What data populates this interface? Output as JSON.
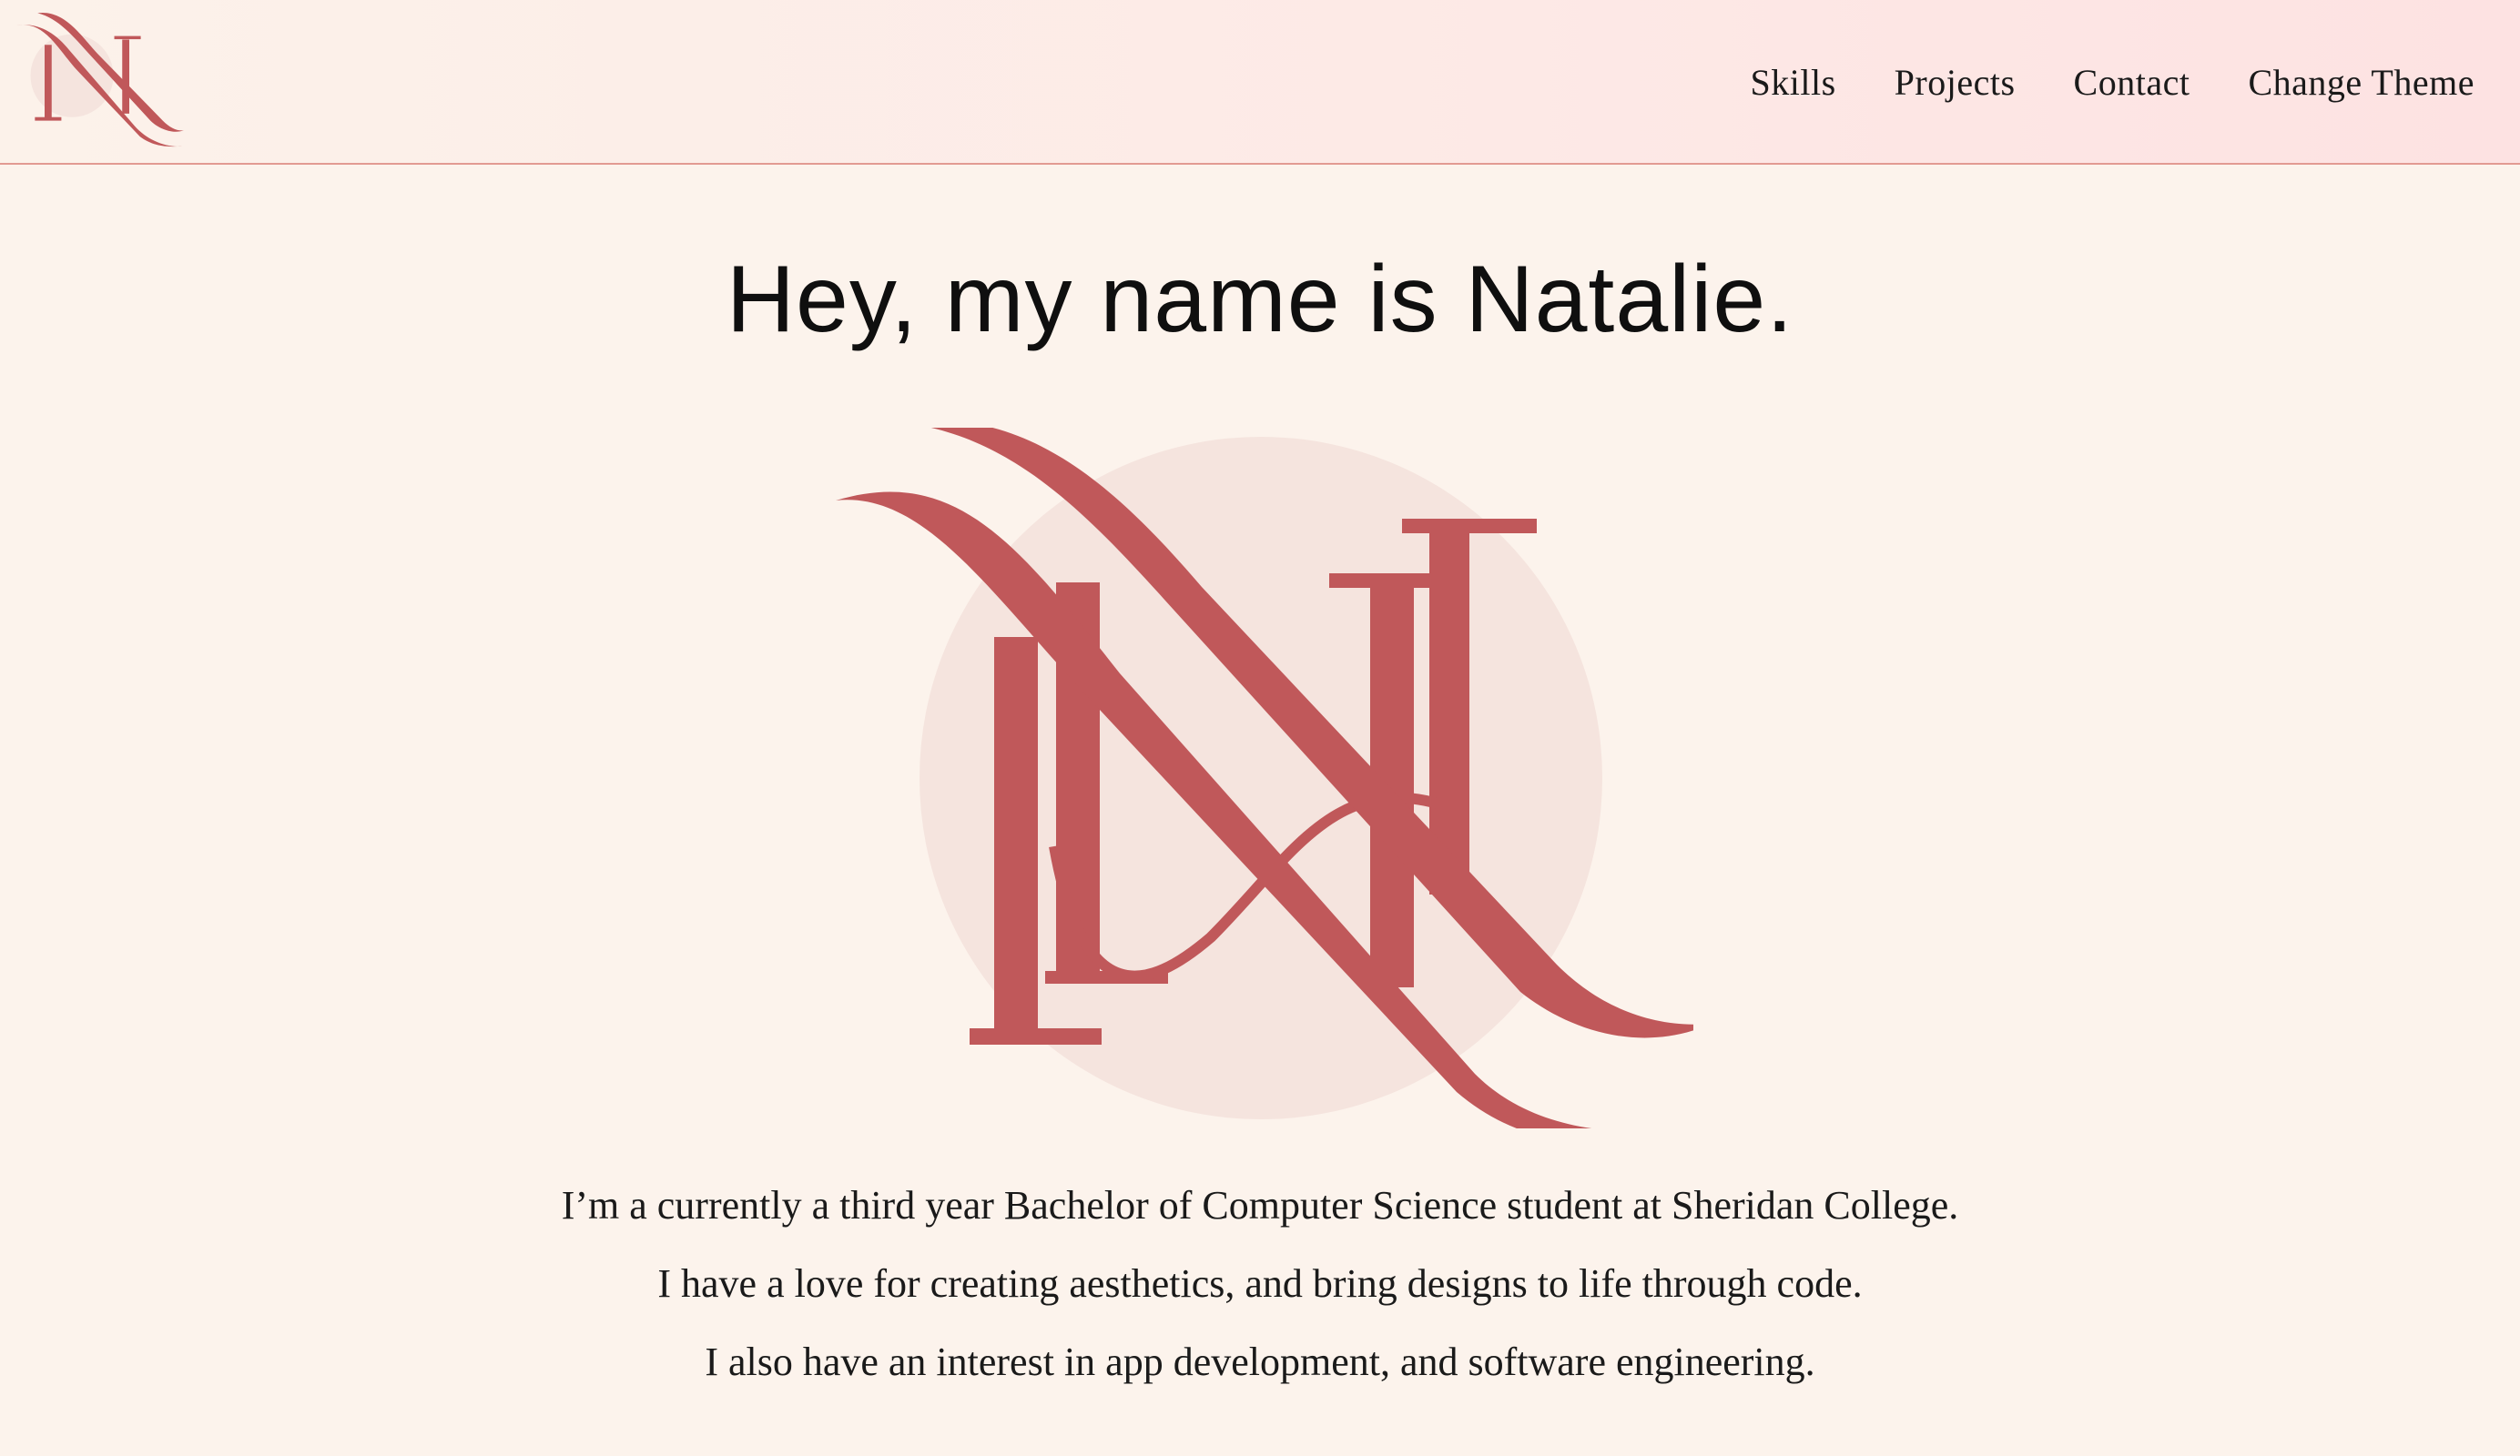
{
  "header": {
    "logo_label": "N",
    "nav": [
      {
        "label": "Skills"
      },
      {
        "label": "Projects"
      },
      {
        "label": "Contact"
      },
      {
        "label": "Change Theme"
      }
    ]
  },
  "hero": {
    "title": "Hey, my name is Natalie.",
    "logo_icon": "monogram-n-logo"
  },
  "intro": {
    "lines": [
      "I’m a currently a third year Bachelor of Computer Science student at Sheridan College.",
      "I have a love for creating aesthetics, and bring designs to life through code.",
      "I also have an interest in app development, and software engineering."
    ]
  },
  "colors": {
    "background": "#fcf3ec",
    "accent": "#c0585a",
    "logo_circle": "#f5e4de",
    "header_border": "#e29a92"
  }
}
